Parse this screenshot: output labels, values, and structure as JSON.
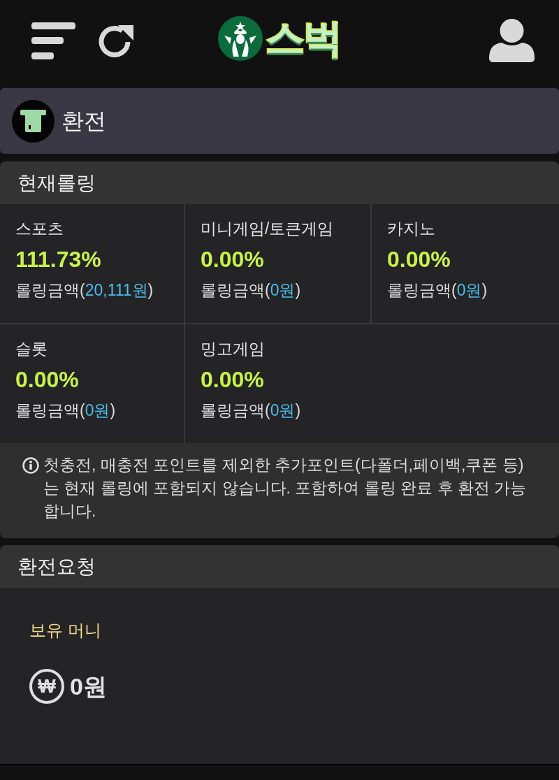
{
  "header": {
    "logo_text": "스벅"
  },
  "page_title": {
    "title": "환전"
  },
  "rolling": {
    "title": "현재롤링",
    "items": [
      {
        "name": "스포츠",
        "percent": "111.73%",
        "amount_label": "롤링금액(",
        "amount": "20,111원",
        "amount_close": ")"
      },
      {
        "name": "미니게임/토큰게임",
        "percent": "0.00%",
        "amount_label": "롤링금액(",
        "amount": "0원",
        "amount_close": ")"
      },
      {
        "name": "카지노",
        "percent": "0.00%",
        "amount_label": "롤링금액(",
        "amount": "0원",
        "amount_close": ")"
      },
      {
        "name": "슬롯",
        "percent": "0.00%",
        "amount_label": "롤링금액(",
        "amount": "0원",
        "amount_close": ")"
      },
      {
        "name": "밍고게임",
        "percent": "0.00%",
        "amount_label": "롤링금액(",
        "amount": "0원",
        "amount_close": ")"
      }
    ],
    "notice": "첫충전, 매충전 포인트를 제외한 추가포인트(다폴더,페이백,쿠폰 등)는 현재 롤링에 포함되지 않습니다. 포함하여 롤링 완료 후 환전 가능합니다."
  },
  "exchange_request": {
    "title": "환전요청",
    "balance_label": "보유 머니",
    "currency_symbol": "₩",
    "balance": "0원"
  }
}
